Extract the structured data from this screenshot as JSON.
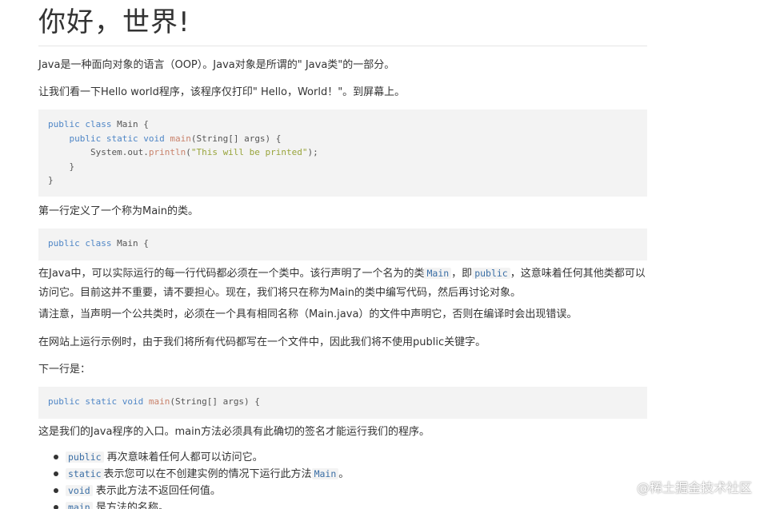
{
  "article": {
    "title": "你好，世界!",
    "intro": "Java是一种面向对象的语言（OOP）。Java对象是所谓的\" Java类\"的一部分。",
    "hello_intro": "让我们看一下Hello world程序，该程序仅打印\" Hello，World！\"。到屏幕上。",
    "code1": {
      "line1": {
        "kw": "public class",
        "name": " Main {"
      },
      "line2": {
        "indent": "    ",
        "kw": "public static void",
        "fn": " main",
        "rest": "(String[] args) {"
      },
      "line3": {
        "indent": "        ",
        "obj": "System.out.",
        "fn": "println",
        "open": "(",
        "str": "\"This will be printed\"",
        "close": ");"
      },
      "line4": "    }",
      "line5": "}"
    },
    "first_line_text": "第一行定义了一个称为Main的类。",
    "code2": {
      "kw": "public class",
      "name": " Main {"
    },
    "injava": {
      "part1": "在Java中，可以实际运行的每一行代码都必须在一个类中。该行声明了一个名为的类",
      "code_main": "Main",
      "part2": "，即",
      "code_public": "public",
      "part3": "，这意味着任何其他类都可以访问它。目前这并不重要，请不要担心。现在，我们将只在称为Main的类中编写代码，然后再讨论对象。"
    },
    "note_text": "请注意，当声明一个公共类时，必须在一个具有相同名称（Main.java）的文件中声明它，否则在编译时会出现错误。",
    "site_text": "在网站上运行示例时，由于我们将所有代码都写在一个文件中，因此我们将不使用public关键字。",
    "next_text": "下一行是：",
    "code3": {
      "kw": "public static void",
      "fn": " main",
      "rest": "(String[] args) {"
    },
    "entry_text": "这是我们的Java程序的入口。main方法必须具有此确切的签名才能运行我们的程序。",
    "bullets": [
      {
        "code": "public",
        "text": " 再次意味着任何人都可以访问它。"
      },
      {
        "code": "static",
        "text": "表示您可以在不创建实例的情况下运行此方法",
        "code2": "Main",
        "text2": "。"
      },
      {
        "code": "void",
        "text": " 表示此方法不返回任何值。"
      },
      {
        "code": "main",
        "text": " 是方法的名称。"
      }
    ]
  },
  "watermark": "@稀土掘金技术社区",
  "colors": {
    "keyword": "#4f86c6",
    "function": "#c9826b",
    "string": "#98a43b",
    "code_bg": "#f3f3f3",
    "text": "#333333"
  }
}
